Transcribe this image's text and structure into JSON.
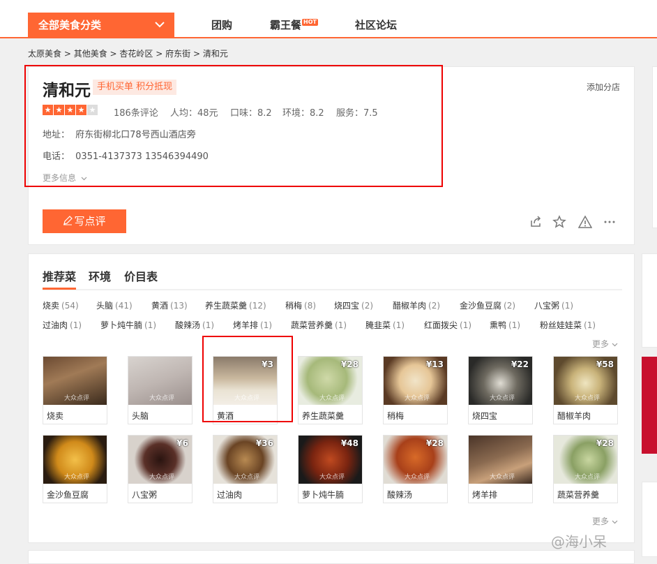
{
  "nav": {
    "category_label": "全部美食分类",
    "links": [
      "团购",
      "霸王餐",
      "社区论坛"
    ],
    "hot_badge": "HOT"
  },
  "breadcrumb": [
    "太原美食",
    "其他美食",
    "杏花岭区",
    "府东街",
    "清和元"
  ],
  "breadcrumb_sep": " > ",
  "shop": {
    "name": "清和元",
    "tags": "手机买单 积分抵现",
    "add_branch": "添加分店",
    "rating_stars": 4,
    "reviews": "186条评论",
    "avg_price": "人均：48元",
    "taste": "口味：8.2",
    "env": "环境：8.2",
    "service": "服务：7.5",
    "address_label": "地址：",
    "address": "府东街柳北口78号西山酒店旁",
    "phone_label": "电话：",
    "phone": "0351-4137373 13546394490",
    "more_info": "更多信息"
  },
  "actions": {
    "write_review": "写点评"
  },
  "tabs": [
    "推荐菜",
    "环境",
    "价目表"
  ],
  "dish_tags": [
    {
      "name": "烧卖",
      "count": "(54)"
    },
    {
      "name": "头脑",
      "count": "(41)"
    },
    {
      "name": "黄酒",
      "count": "(13)"
    },
    {
      "name": "养生蔬菜羹",
      "count": "(12)"
    },
    {
      "name": "稍梅",
      "count": "(8)"
    },
    {
      "name": "烧四宝",
      "count": "(2)"
    },
    {
      "name": "醋椒羊肉",
      "count": "(2)"
    },
    {
      "name": "金沙鱼豆腐",
      "count": "(2)"
    },
    {
      "name": "八宝粥",
      "count": "(1)"
    },
    {
      "name": "过油肉",
      "count": "(1)"
    },
    {
      "name": "萝卜炖牛腩",
      "count": "(1)"
    },
    {
      "name": "酸辣汤",
      "count": "(1)"
    },
    {
      "name": "烤羊排",
      "count": "(1)"
    },
    {
      "name": "蔬菜营养羹",
      "count": "(1)"
    },
    {
      "name": "腌韭菜",
      "count": "(1)"
    },
    {
      "name": "红面拨尖",
      "count": "(1)"
    },
    {
      "name": "熏鸭",
      "count": "(1)"
    },
    {
      "name": "粉丝娃娃菜",
      "count": "(1)"
    }
  ],
  "more_label": "更多",
  "watermark": "大众点评",
  "dishes": [
    {
      "name": "烧卖",
      "price": ""
    },
    {
      "name": "头脑",
      "price": ""
    },
    {
      "name": "黄酒",
      "price": "¥3"
    },
    {
      "name": "养生蔬菜羹",
      "price": "¥28"
    },
    {
      "name": "稍梅",
      "price": "¥13"
    },
    {
      "name": "烧四宝",
      "price": "¥22"
    },
    {
      "name": "醋椒羊肉",
      "price": "¥58"
    },
    {
      "name": "金沙鱼豆腐",
      "price": ""
    },
    {
      "name": "八宝粥",
      "price": "¥6"
    },
    {
      "name": "过油肉",
      "price": "¥36"
    },
    {
      "name": "萝卜炖牛腩",
      "price": "¥48"
    },
    {
      "name": "酸辣汤",
      "price": "¥28"
    },
    {
      "name": "烤羊排",
      "price": ""
    },
    {
      "name": "蔬菜营养羹",
      "price": "¥28"
    }
  ],
  "weibo_watermark": "@海小呆",
  "colors": {
    "accent": "#ff6633",
    "highlight_box": "#ee0000"
  }
}
